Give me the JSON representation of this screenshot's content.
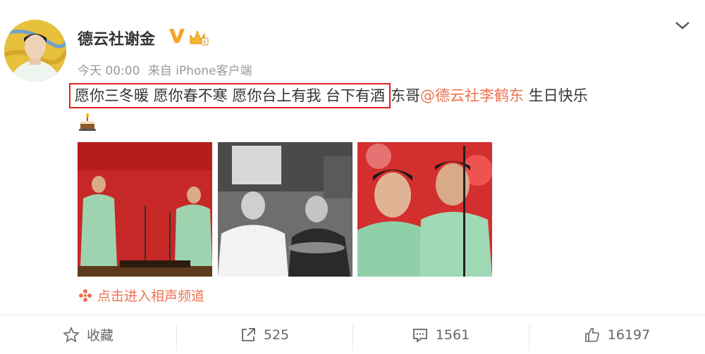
{
  "post": {
    "username": "德云社谢金",
    "verified_icon": "verified-v-icon",
    "member_icon": "crown-icon",
    "time": "今天 00:00",
    "source": "来自 iPhone客户端",
    "text_highlight": "愿你三冬暖 愿你春不寒 愿你台上有我 台下有酒",
    "text_after": "东哥",
    "mention": "@德云社李鹤东",
    "text_end": " 生日快乐",
    "emoji": "cake-icon"
  },
  "topic": {
    "label": "点击进入相声频道"
  },
  "actions": {
    "favorite_label": "收藏",
    "repost_count": "525",
    "comment_count": "1561",
    "like_count": "16197"
  },
  "colors": {
    "accent": "#eb7350",
    "highlight_border": "#e02020",
    "verified": "#f5a623",
    "muted": "#999999"
  }
}
